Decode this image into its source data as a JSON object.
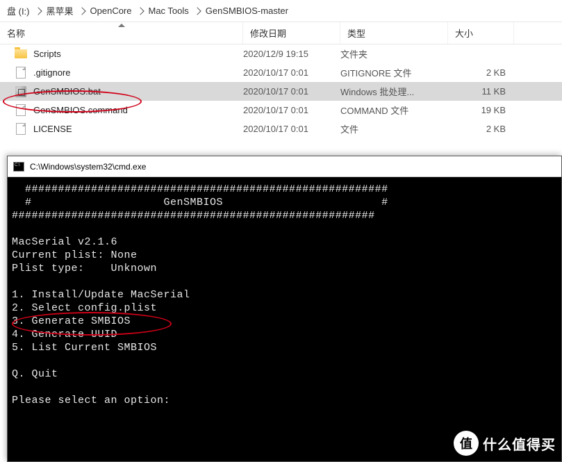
{
  "breadcrumb": {
    "items": [
      "盘 (I:)",
      "黑苹果",
      "OpenCore",
      "Mac Tools",
      "GenSMBIOS-master"
    ]
  },
  "columns": {
    "name": "名称",
    "date": "修改日期",
    "type": "类型",
    "size": "大小"
  },
  "files": [
    {
      "icon": "folder",
      "name": "Scripts",
      "date": "2020/12/9 19:15",
      "type": "文件夹",
      "size": "",
      "selected": false
    },
    {
      "icon": "file",
      "name": ".gitignore",
      "date": "2020/10/17 0:01",
      "type": "GITIGNORE 文件",
      "size": "2 KB",
      "selected": false
    },
    {
      "icon": "bat",
      "name": "GenSMBIOS.bat",
      "date": "2020/10/17 0:01",
      "type": "Windows 批处理...",
      "size": "11 KB",
      "selected": true
    },
    {
      "icon": "file",
      "name": "GenSMBIOS.command",
      "date": "2020/10/17 0:01",
      "type": "COMMAND 文件",
      "size": "19 KB",
      "selected": false
    },
    {
      "icon": "file",
      "name": "LICENSE",
      "date": "2020/10/17 0:01",
      "type": "文件",
      "size": "2 KB",
      "selected": false
    }
  ],
  "cmd": {
    "title": "C:\\Windows\\system32\\cmd.exe",
    "lines": [
      "  #######################################################",
      "  #                    GenSMBIOS                        #",
      "#######################################################",
      "",
      "MacSerial v2.1.6",
      "Current plist: None",
      "Plist type:    Unknown",
      "",
      "1. Install/Update MacSerial",
      "2. Select config.plist",
      "3. Generate SMBIOS",
      "4. Generate UUID",
      "5. List Current SMBIOS",
      "",
      "Q. Quit",
      "",
      "Please select an option:"
    ]
  },
  "watermark": {
    "badge": "值",
    "text": "什么值得买"
  }
}
